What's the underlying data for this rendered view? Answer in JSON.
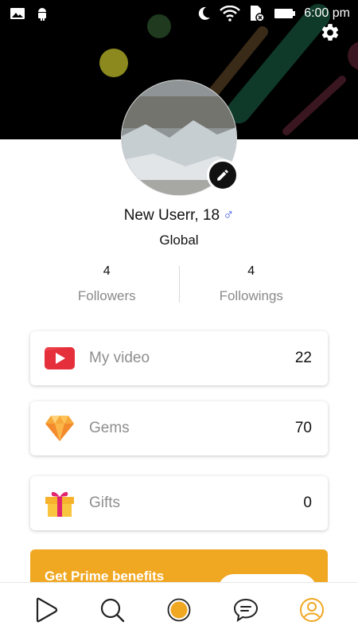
{
  "status_bar": {
    "time": "6:00 pm"
  },
  "profile": {
    "name": "New Userr, 18",
    "gender_symbol": "♂",
    "region": "Global"
  },
  "stats": {
    "followers": {
      "count": "4",
      "label": "Followers"
    },
    "followings": {
      "count": "4",
      "label": "Followings"
    }
  },
  "cards": {
    "video": {
      "label": "My video",
      "value": "22"
    },
    "gems": {
      "label": "Gems",
      "value": "70"
    },
    "gifts": {
      "label": "Gifts",
      "value": "0"
    }
  },
  "prime": {
    "text": "Get Prime benefits"
  },
  "colors": {
    "accent": "#f0a722",
    "header_bg": "#000000",
    "gender_blue": "#3b55d8",
    "muted_text": "#8e8e8e"
  },
  "icons": {
    "status_left": [
      "gallery-icon",
      "android-icon"
    ],
    "status_right": [
      "moon-icon",
      "wifi-icon",
      "sim-icon",
      "battery-icon"
    ],
    "settings": "gear-icon",
    "edit": "pencil-icon",
    "cards": [
      "youtube-play-icon",
      "diamond-icon",
      "gift-icon"
    ],
    "nav": [
      "play-icon",
      "search-icon",
      "record-icon",
      "chat-icon",
      "profile-icon"
    ],
    "active_nav": "profile-icon"
  }
}
